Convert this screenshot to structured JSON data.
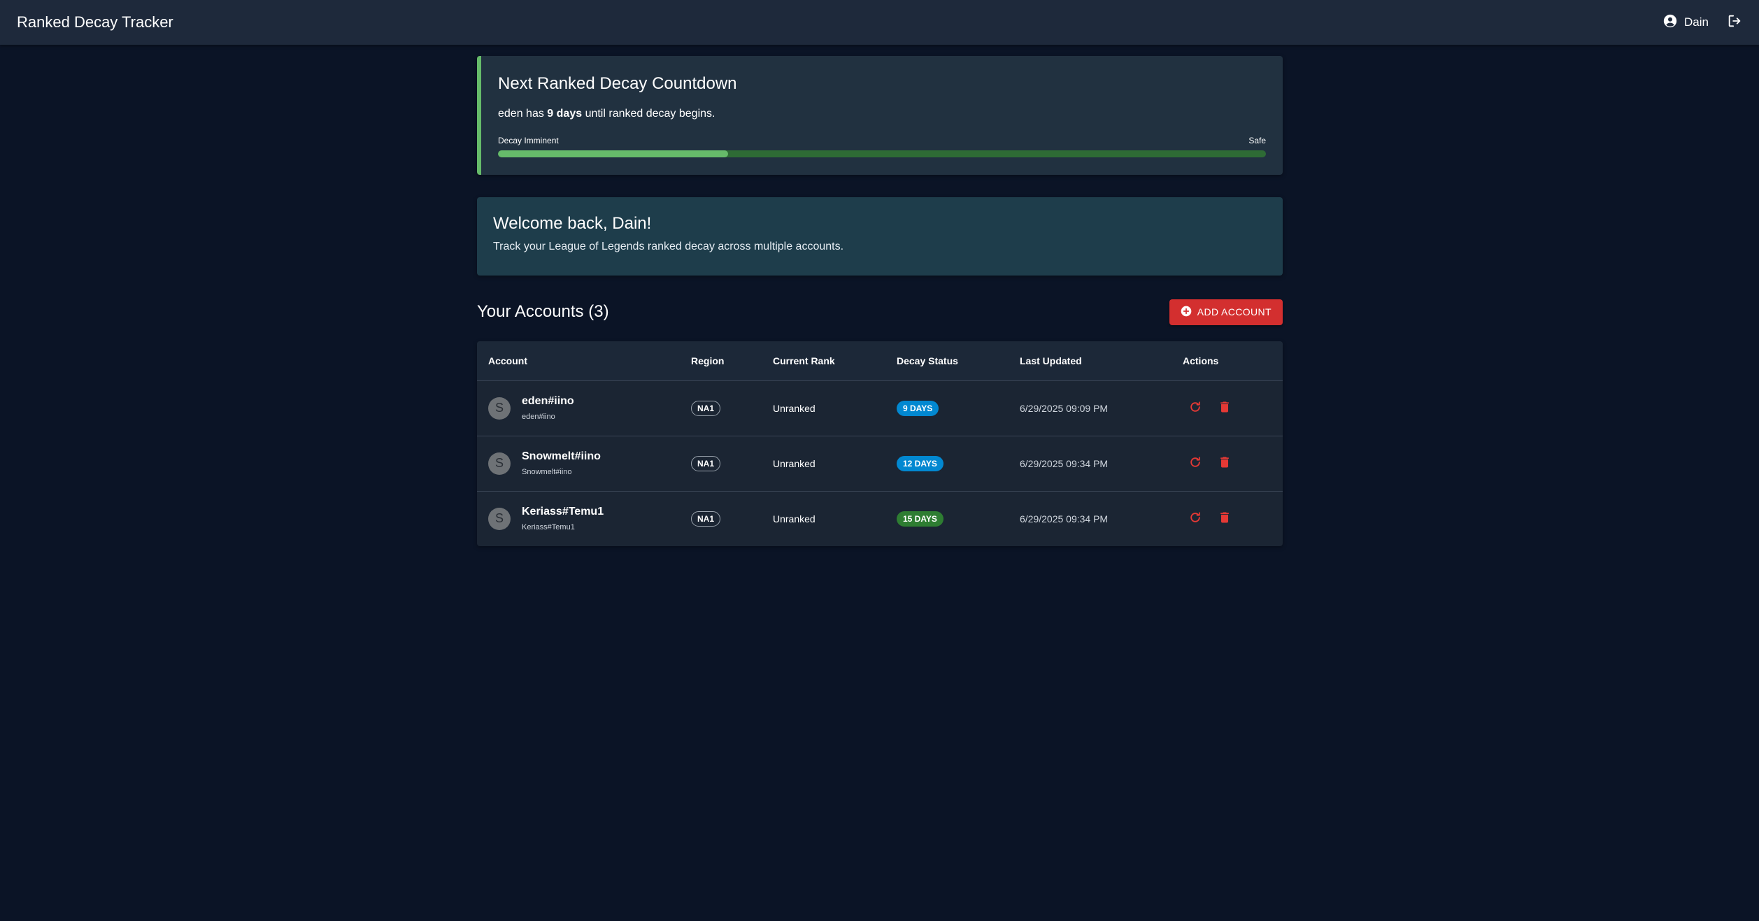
{
  "app": {
    "title": "Ranked Decay Tracker"
  },
  "user": {
    "name": "Dain"
  },
  "icons": {
    "user": "account-circle-icon",
    "logout": "logout-icon",
    "add": "add-circle-icon",
    "refresh": "refresh-icon",
    "delete": "trash-icon"
  },
  "countdown": {
    "title": "Next Ranked Decay Countdown",
    "account": "eden",
    "text_before": "has",
    "days": "9 days",
    "text_after": "until ranked decay begins.",
    "label_left": "Decay Imminent",
    "label_right": "Safe",
    "progress_percent": 30,
    "accent_color": "#66bb6a"
  },
  "welcome": {
    "title": "Welcome back, Dain!",
    "subtitle": "Track your League of Legends ranked decay across multiple accounts."
  },
  "accounts_section": {
    "title": "Your Accounts (3)",
    "add_label": "ADD ACCOUNT",
    "add_color": "#d32f2f"
  },
  "table": {
    "columns": [
      "Account",
      "Region",
      "Current Rank",
      "Decay Status",
      "Last Updated",
      "Actions"
    ],
    "rows": [
      {
        "avatar": "S",
        "name": "eden#iino",
        "sub": "eden#iino",
        "region": "NA1",
        "rank": "Unranked",
        "decay": "9 DAYS",
        "decay_color": "#0288d1",
        "updated": "6/29/2025 09:09 PM"
      },
      {
        "avatar": "S",
        "name": "Snowmelt#iino",
        "sub": "Snowmelt#iino",
        "region": "NA1",
        "rank": "Unranked",
        "decay": "12 DAYS",
        "decay_color": "#0288d1",
        "updated": "6/29/2025 09:34 PM"
      },
      {
        "avatar": "S",
        "name": "Keriass#Temu1",
        "sub": "Keriass#Temu1",
        "region": "NA1",
        "rank": "Unranked",
        "decay": "15 DAYS",
        "decay_color": "#2e7d32",
        "updated": "6/29/2025 09:34 PM"
      }
    ]
  }
}
